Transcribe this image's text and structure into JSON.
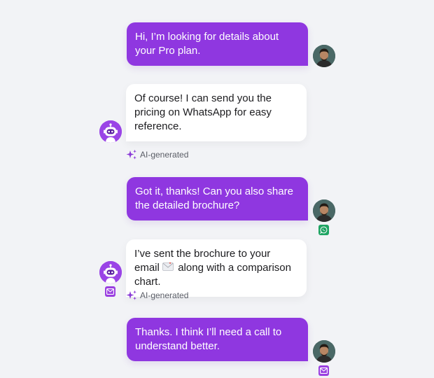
{
  "conversation": {
    "messages": [
      {
        "sender": "user",
        "text": "Hi, I’m looking for details about your Pro plan."
      },
      {
        "sender": "bot",
        "text": "Of course! I can send you the pricing on WhatsApp for easy reference.",
        "tag": "AI-generated"
      },
      {
        "sender": "user",
        "text": "Got it, thanks! Can you also share the detailed brochure?",
        "channel": "whatsapp-icon"
      },
      {
        "sender": "bot",
        "text_before_icon": "I’ve sent the brochure to your email",
        "text_after_icon": "along with a comparison chart.",
        "inline_icon": "envelope-emoji-icon",
        "tag": "AI-generated",
        "channel": "email-icon"
      },
      {
        "sender": "user",
        "text": "Thanks. I think I’ll need a call to understand better.",
        "channel": "email-icon"
      }
    ]
  },
  "colors": {
    "user_bubble": "#8f37e0",
    "bot_bubble": "#ffffff",
    "background": "#f2f3f6",
    "whatsapp": "#1fa463",
    "email": "#9a3fe0",
    "ai_sparkle": "#8a3ad6"
  }
}
